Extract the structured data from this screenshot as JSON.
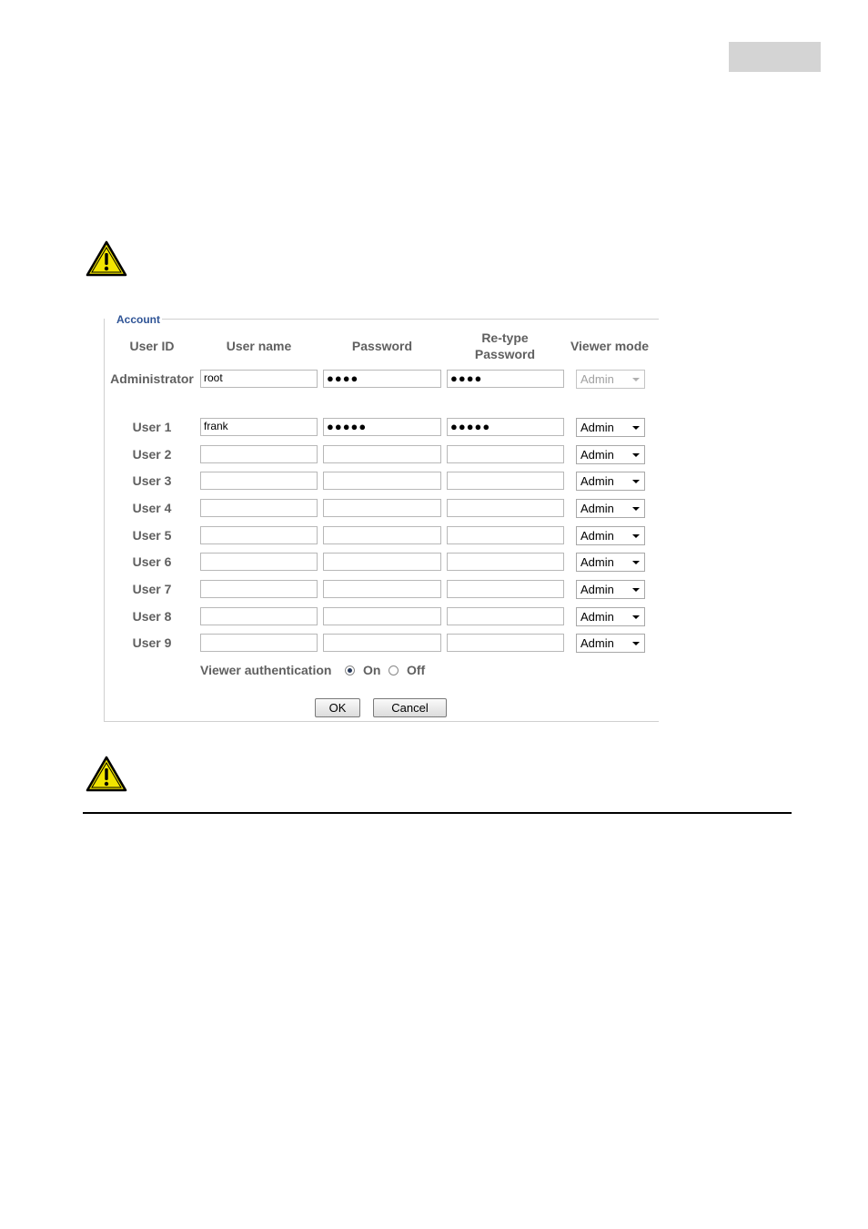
{
  "account": {
    "legend": "Account",
    "headers": {
      "user_id": "User ID",
      "user_name": "User name",
      "password": "Password",
      "retype_line1": "Re-type",
      "retype_line2": "Password",
      "viewer_mode": "Viewer mode"
    },
    "admin": {
      "label": "Administrator",
      "user_name": "root",
      "password": "●●●●",
      "retype": "●●●●",
      "mode": "Admin"
    },
    "users": [
      {
        "label": "User 1",
        "user_name": "frank",
        "password": "●●●●●",
        "retype": "●●●●●",
        "mode": "Admin"
      },
      {
        "label": "User 2",
        "user_name": "",
        "password": "",
        "retype": "",
        "mode": "Admin"
      },
      {
        "label": "User 3",
        "user_name": "",
        "password": "",
        "retype": "",
        "mode": "Admin"
      },
      {
        "label": "User 4",
        "user_name": "",
        "password": "",
        "retype": "",
        "mode": "Admin"
      },
      {
        "label": "User 5",
        "user_name": "",
        "password": "",
        "retype": "",
        "mode": "Admin"
      },
      {
        "label": "User 6",
        "user_name": "",
        "password": "",
        "retype": "",
        "mode": "Admin"
      },
      {
        "label": "User 7",
        "user_name": "",
        "password": "",
        "retype": "",
        "mode": "Admin"
      },
      {
        "label": "User 8",
        "user_name": "",
        "password": "",
        "retype": "",
        "mode": "Admin"
      },
      {
        "label": "User 9",
        "user_name": "",
        "password": "",
        "retype": "",
        "mode": "Admin"
      }
    ],
    "viewer_auth": {
      "label": "Viewer authentication",
      "on_label": "On",
      "off_label": "Off",
      "selected": "On"
    },
    "buttons": {
      "ok": "OK",
      "cancel": "Cancel"
    }
  },
  "icons": {
    "warning": "warning-triangle-icon"
  },
  "colors": {
    "legend": "#2f5496",
    "warning_fill": "#f2e500"
  }
}
